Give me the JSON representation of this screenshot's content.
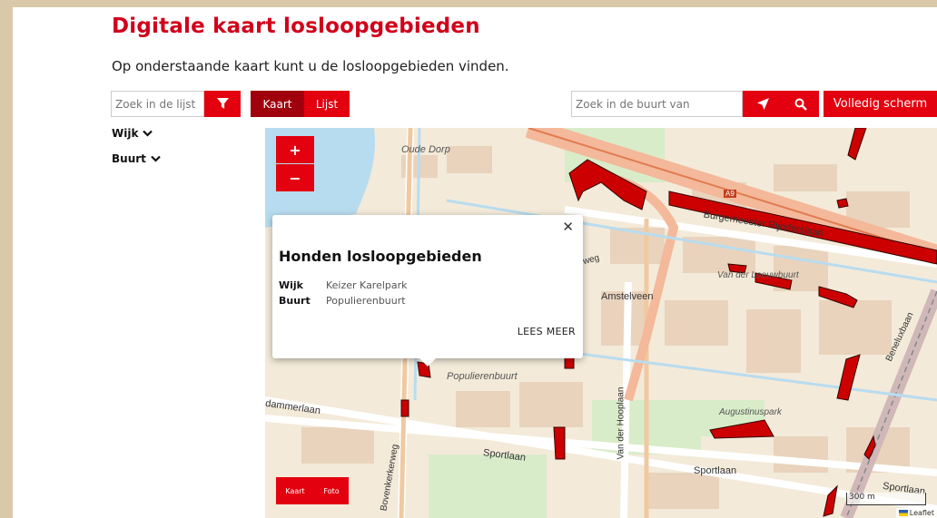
{
  "header": {
    "title": "Digitale kaart losloopgebieden",
    "subtitle": "Op onderstaande kaart kunt u de losloopgebieden vinden."
  },
  "toolbar": {
    "list_search_placeholder": "Zoek in de lijst",
    "view_tabs": [
      {
        "label": "Kaart",
        "active": true
      },
      {
        "label": "Lijst",
        "active": false
      }
    ],
    "buurt_search_placeholder": "Zoek in de buurt van",
    "fullscreen_label": "Volledig scherm"
  },
  "filters": [
    {
      "label": "Wijk"
    },
    {
      "label": "Buurt"
    }
  ],
  "map": {
    "zoom_in": "+",
    "zoom_out": "−",
    "layer_switch": {
      "map_label": "Kaart",
      "photo_label": "Foto"
    },
    "scale_label": "300 m",
    "attribution": "Leaflet",
    "place_labels": {
      "oude_dorp": "Oude Dorp",
      "amstelveen": "Amstelveen",
      "populierenbuurt": "Populierenbuurt",
      "van_der_leeuwbuurt": "Van der Leeuwbuurt",
      "augustinuspark": "Augustinuspark"
    },
    "road_labels": {
      "burgemeester": "Burgemeester Rijnderslaan",
      "sportlaan_1": "Sportlaan",
      "sportlaan_2": "Sportlaan",
      "sportlaan_3": "Sportlaan",
      "van_der_hooplaan": "Van der Hooplaan",
      "bovenkerkerweg": "Bovenkerkerweg",
      "dammerlaan": "dammerlaan",
      "beneluxbaan": "Beneluxbaan",
      "a9": "A9",
      "weg": "weg"
    }
  },
  "popup": {
    "title": "Honden losloopgebieden",
    "rows": [
      {
        "key": "Wijk",
        "value": "Keizer Karelpark"
      },
      {
        "key": "Buurt",
        "value": "Populierenbuurt"
      }
    ],
    "more_label": "LEES MEER"
  },
  "colors": {
    "brand_red": "#e3000f",
    "active_tab": "#a0000b",
    "title_red": "#d0021b",
    "area_fill": "#cc0000"
  }
}
